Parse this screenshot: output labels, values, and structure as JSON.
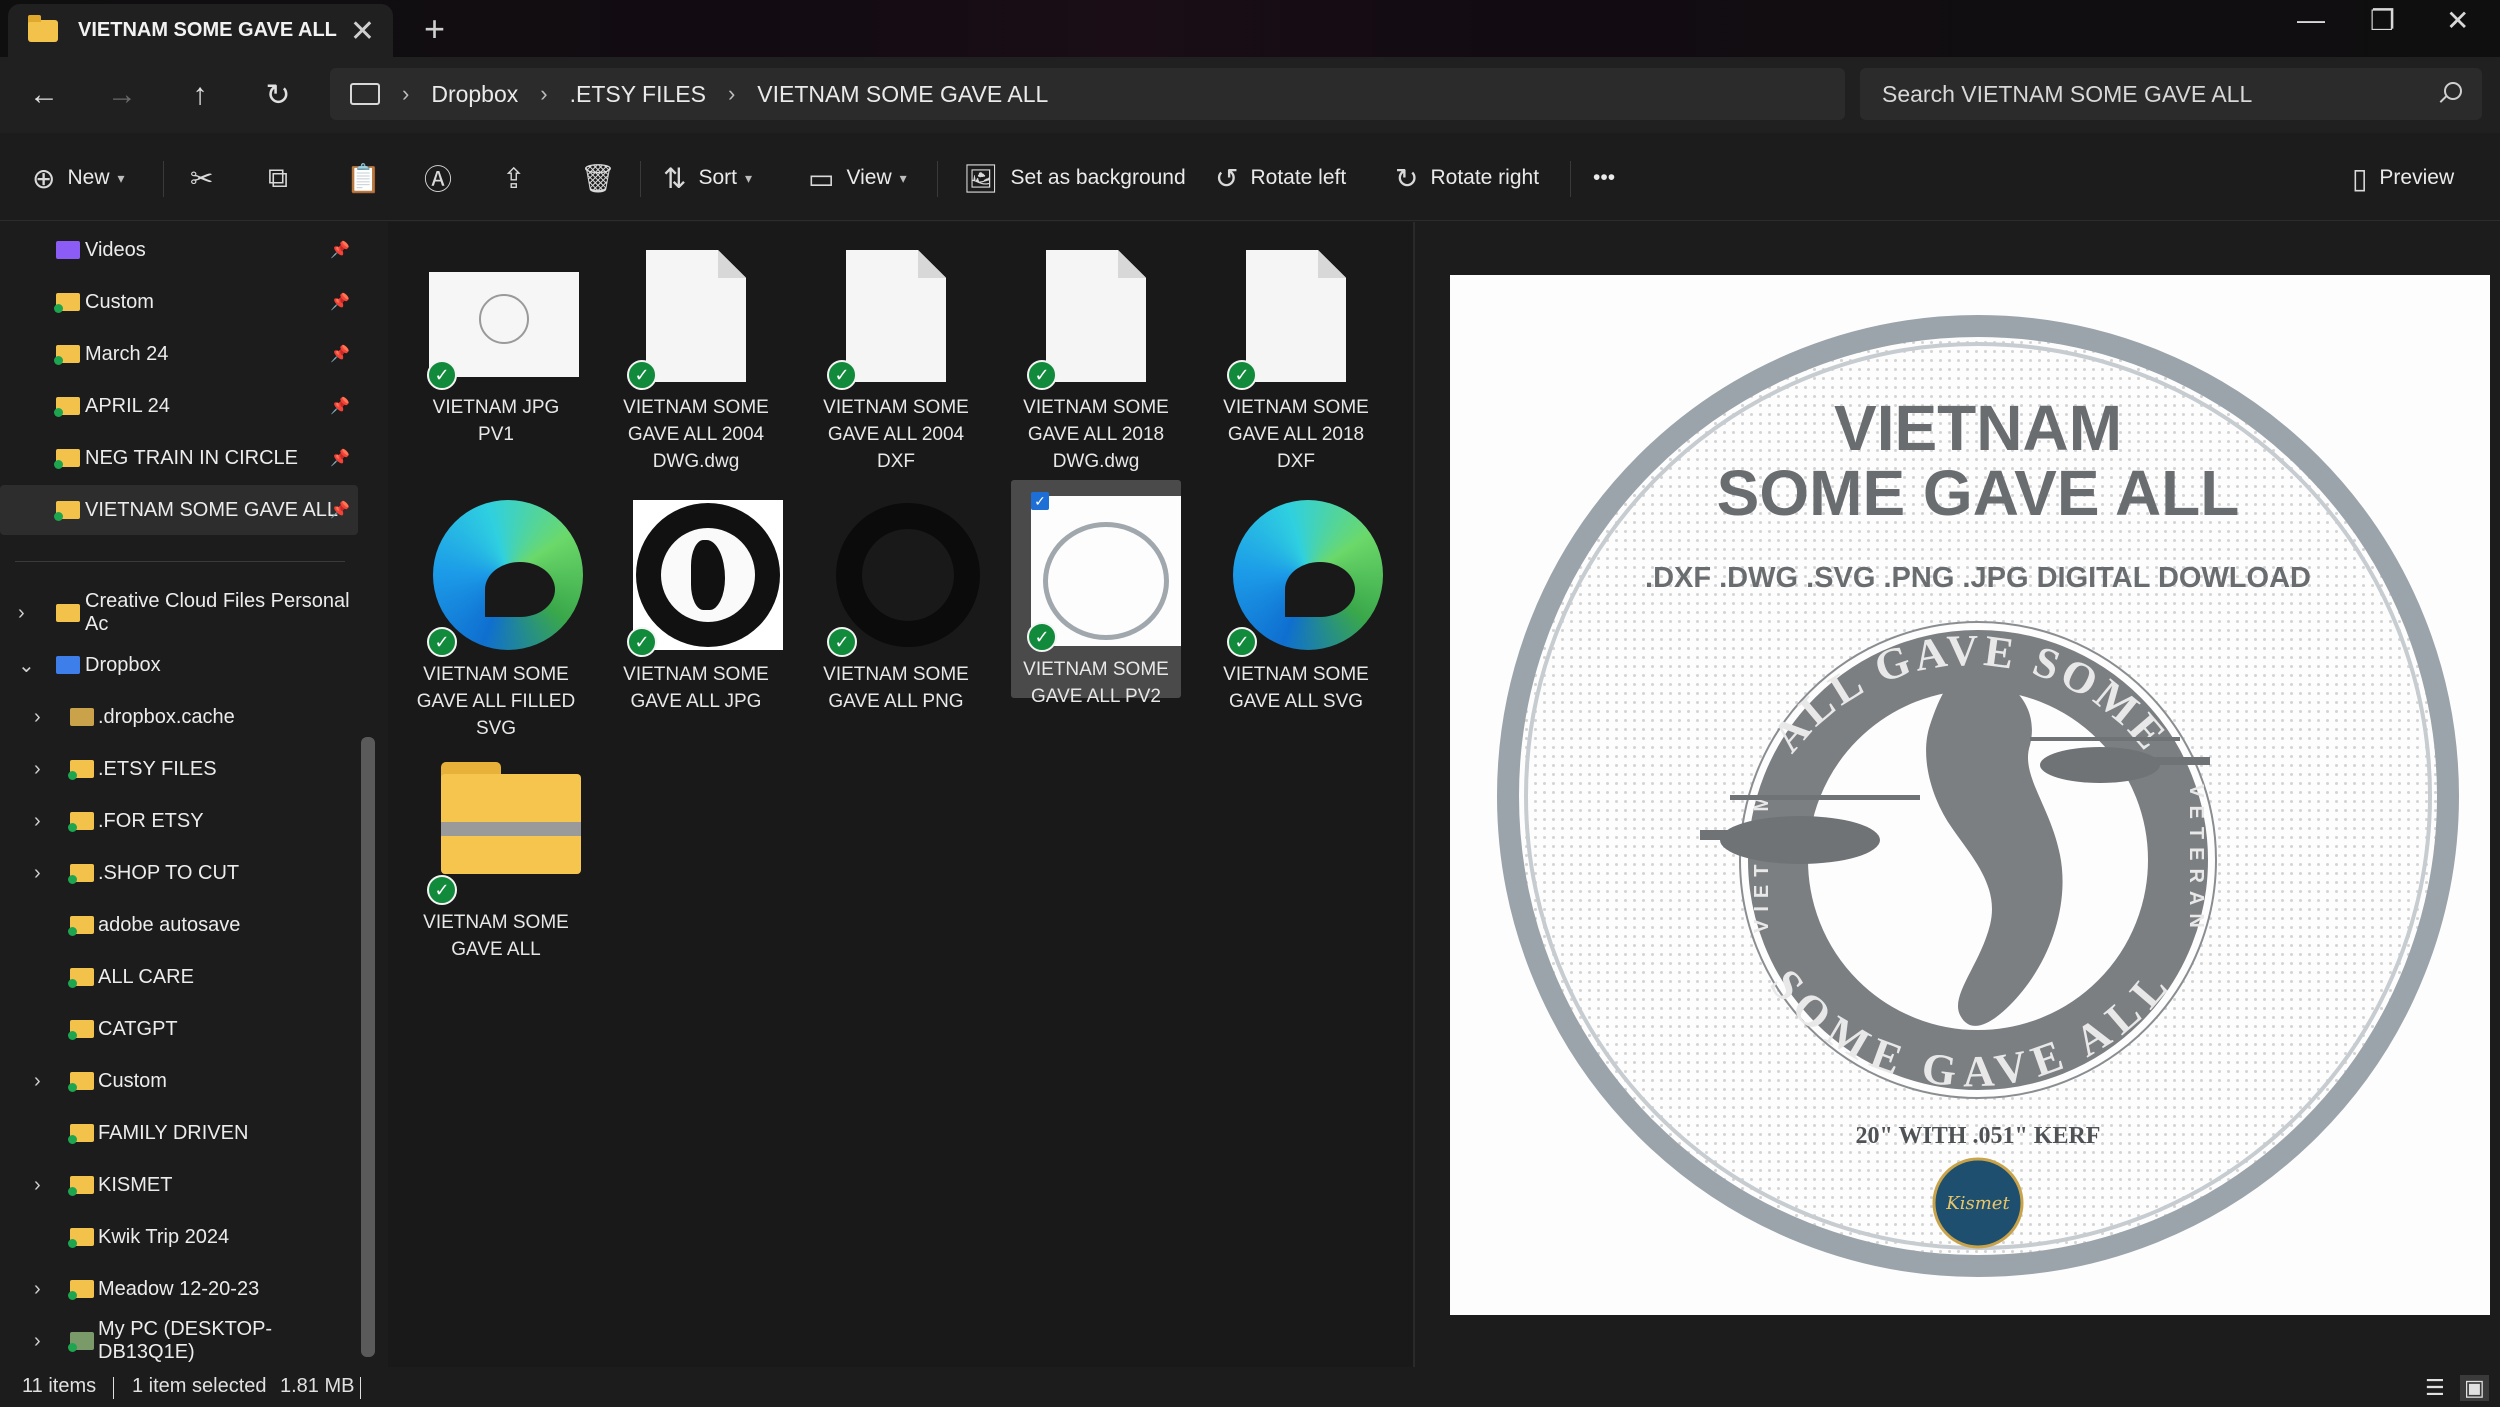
{
  "tab": {
    "title": "VIETNAM SOME GAVE ALL",
    "close": "✕",
    "new": "+"
  },
  "window": {
    "minimize": "—",
    "maximize": "❐",
    "close": "✕"
  },
  "breadcrumb": [
    "Dropbox",
    ".ETSY FILES",
    "VIETNAM SOME GAVE ALL"
  ],
  "search": {
    "placeholder": "Search VIETNAM SOME GAVE ALL"
  },
  "toolbar": {
    "new": "New",
    "sort": "Sort",
    "view": "View",
    "set_background": "Set as background",
    "rotate_left": "Rotate left",
    "rotate_right": "Rotate right",
    "more": "•••",
    "preview": "Preview"
  },
  "sidebar": {
    "quick": [
      "Videos",
      "Custom",
      "March 24",
      "APRIL 24",
      "NEG TRAIN IN CIRCLE",
      "VIETNAM SOME GAVE ALL"
    ],
    "tree": [
      "Creative Cloud Files Personal Ac",
      "Dropbox",
      ".dropbox.cache",
      ".ETSY FILES",
      ".FOR ETSY",
      ".SHOP TO CUT",
      "adobe autosave",
      "ALL CARE",
      "CATGPT",
      "Custom",
      "FAMILY DRIVEN",
      "KISMET",
      "Kwik Trip 2024",
      "Meadow 12-20-23",
      "My PC (DESKTOP-DB13Q1E)"
    ]
  },
  "files": [
    {
      "line1": "VIETNAM JPG",
      "line2": "PV1",
      "line3": ""
    },
    {
      "line1": "VIETNAM SOME",
      "line2": "GAVE ALL 2004",
      "line3": "DWG.dwg"
    },
    {
      "line1": "VIETNAM SOME",
      "line2": "GAVE ALL 2004",
      "line3": "DXF"
    },
    {
      "line1": "VIETNAM SOME",
      "line2": "GAVE ALL 2018",
      "line3": "DWG.dwg"
    },
    {
      "line1": "VIETNAM SOME",
      "line2": "GAVE ALL 2018",
      "line3": "DXF"
    },
    {
      "line1": "VIETNAM SOME",
      "line2": "GAVE ALL FILLED",
      "line3": "SVG"
    },
    {
      "line1": "VIETNAM SOME",
      "line2": "GAVE ALL JPG",
      "line3": ""
    },
    {
      "line1": "VIETNAM SOME",
      "line2": "GAVE ALL PNG",
      "line3": ""
    },
    {
      "line1": "VIETNAM SOME",
      "line2": "GAVE ALL PV2",
      "line3": ""
    },
    {
      "line1": "VIETNAM SOME",
      "line2": "GAVE ALL SVG",
      "line3": ""
    },
    {
      "line1": "VIETNAM SOME",
      "line2": "GAVE ALL",
      "line3": ""
    }
  ],
  "preview_image": {
    "title1": "VIETNAM",
    "title2": "SOME GAVE ALL",
    "formats": ".DXF .DWG .SVG .PNG .JPG DIGITAL DOWLOAD",
    "arc_top": "ALL GAVE SOME",
    "arc_bottom": "SOME GAVE ALL",
    "arc_left": "VIETNAM",
    "arc_right": "VETERAN",
    "size": "20\" WITH .051\" KERF",
    "logo": "Kismet"
  },
  "status": {
    "count": "11 items",
    "selected": "1 item selected",
    "size": "1.81 MB"
  },
  "colors": {
    "accent": "#1d6fd6",
    "sync_green": "#128a3c",
    "folder": "#f3c24a"
  }
}
